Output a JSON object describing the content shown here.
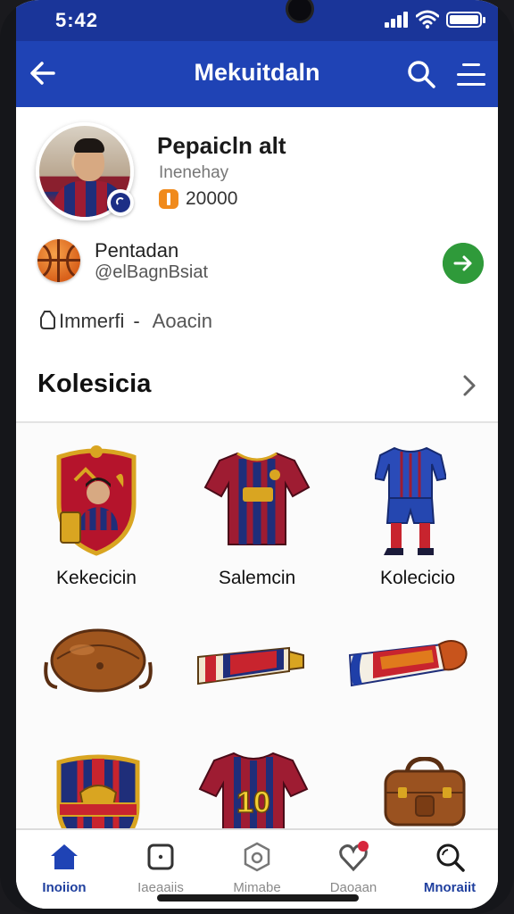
{
  "status_bar": {
    "time": "5:42"
  },
  "app_bar": {
    "title": "Mekuitdaln"
  },
  "profile": {
    "name": "Pepaicln alt",
    "subtitle": "Inenehay",
    "coins": "20000"
  },
  "account": {
    "name": "Pentadan",
    "handle": "@elBagnBsiat"
  },
  "info": {
    "label": "Immerfi",
    "separator": "-",
    "value": "Aoacin"
  },
  "section": {
    "title": "Kolesicia"
  },
  "collection": [
    {
      "label": "Kekecicin",
      "icon": "club-crest-player-icon"
    },
    {
      "label": "Salemcin",
      "icon": "jersey-icon"
    },
    {
      "label": "Kolecicio",
      "icon": "kit-icon"
    },
    {
      "label": "",
      "icon": "leather-bag-icon"
    },
    {
      "label": "",
      "icon": "scarf-icon"
    },
    {
      "label": "",
      "icon": "scarf-fist-icon"
    },
    {
      "label": "",
      "icon": "crest-icon"
    },
    {
      "label": "",
      "icon": "jersey-10-icon"
    },
    {
      "label": "",
      "icon": "travel-bag-icon"
    }
  ],
  "collection_numbers": {
    "jersey_number": "10"
  },
  "bottom_nav": [
    {
      "label": "Inoiion",
      "icon": "home-icon",
      "active": true
    },
    {
      "label": "Iaeaaiis",
      "icon": "square-icon",
      "active": false
    },
    {
      "label": "Mimabe",
      "icon": "hexagon-icon",
      "active": false
    },
    {
      "label": "Daoaan",
      "icon": "heart-shield-icon",
      "active": false
    },
    {
      "label": "Mnoraiit",
      "icon": "search-icon",
      "active": false
    }
  ],
  "colors": {
    "brand_blue": "#1f43b5",
    "status_blue": "#1a3599",
    "go_green": "#2f9a3a",
    "coin_orange": "#f08a1c"
  }
}
